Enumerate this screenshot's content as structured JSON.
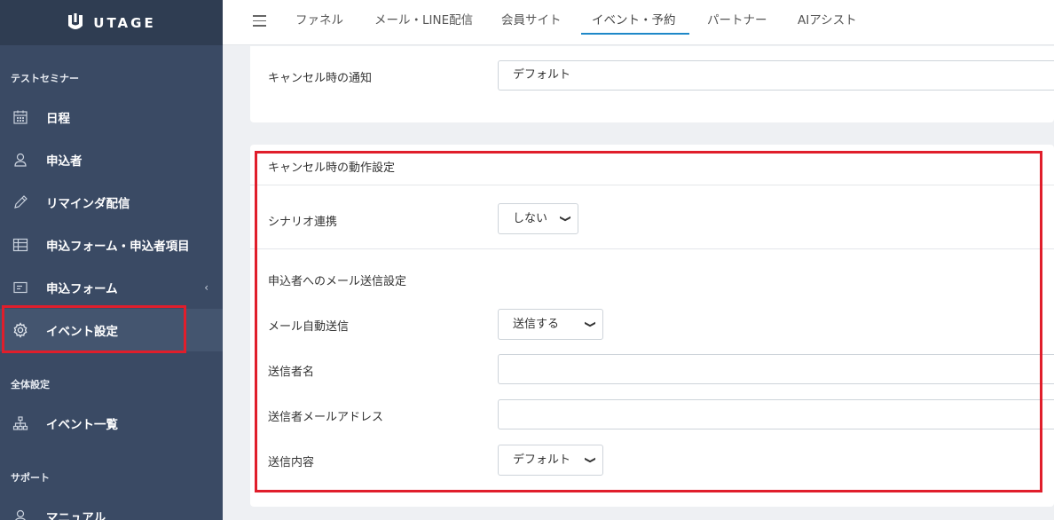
{
  "brand": {
    "name": "UTAGE"
  },
  "sidebar": {
    "section1": "テストセミナー",
    "items": [
      {
        "label": "日程",
        "icon": "calendar-icon"
      },
      {
        "label": "申込者",
        "icon": "person-icon"
      },
      {
        "label": "リマインダ配信",
        "icon": "pencil-icon"
      },
      {
        "label": "申込フォーム・申込者項目",
        "icon": "table-icon"
      },
      {
        "label": "申込フォーム",
        "icon": "form-icon",
        "chevron": "‹"
      },
      {
        "label": "イベント設定",
        "icon": "gear-icon"
      }
    ],
    "section2": "全体設定",
    "items2": [
      {
        "label": "イベント一覧",
        "icon": "sitemap-icon"
      }
    ],
    "section3": "サポート",
    "items3": [
      {
        "label": "マニュアル",
        "icon": "person-icon"
      }
    ]
  },
  "topnav": {
    "tabs": [
      {
        "label": "ファネル"
      },
      {
        "label": "メール・LINE配信"
      },
      {
        "label": "会員サイト"
      },
      {
        "label": "イベント・予約"
      },
      {
        "label": "パートナー"
      },
      {
        "label": "AIアシスト"
      }
    ],
    "active_tab": "イベント・予約"
  },
  "cancel_notice": {
    "label": "キャンセル時の通知",
    "value": "デフォルト"
  },
  "cancel_action": {
    "heading": "キャンセル時の動作設定",
    "scenario": {
      "label": "シナリオ連携",
      "value": "しない"
    },
    "mail_heading": "申込者へのメール送信設定",
    "auto_send": {
      "label": "メール自動送信",
      "value": "送信する"
    },
    "sender_name": {
      "label": "送信者名",
      "value": ""
    },
    "sender_email": {
      "label": "送信者メールアドレス",
      "value": ""
    },
    "content": {
      "label": "送信内容",
      "value": "デフォルト"
    }
  },
  "colors": {
    "sidebar": "#3a4a64",
    "logo_bar": "#2f3d52",
    "accent": "#1e88c8",
    "highlight": "#e01e2b"
  }
}
